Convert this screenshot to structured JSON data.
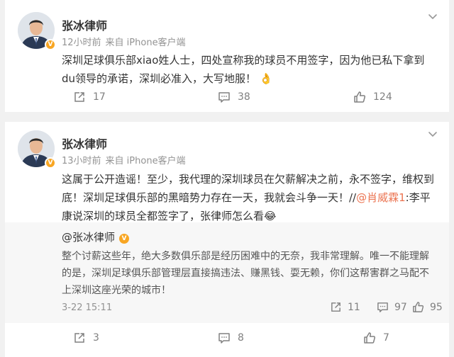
{
  "posts": [
    {
      "author": "张冰律师",
      "verified_badge": "V",
      "time": "12小时前",
      "source": "来自 iPhone客户端",
      "text": "深圳足球俱乐部xiao姓人士，四处宣称我的球员不用签字，因为他已私下拿到du领导的承诺，深圳必准入，大写地服！",
      "emoji": "👌",
      "actions": {
        "repost": "17",
        "comment": "38",
        "like": "124"
      }
    },
    {
      "author": "张冰律师",
      "verified_badge": "V",
      "time": "13小时前",
      "source": "来自 iPhone客户端",
      "text_before": "这属于公开造谣！至少，我代理的深圳球员在欠薪解决之前，永不签字，维权到底！深圳足球俱乐部的黑暗势力存在一天，我就会斗争一天！//",
      "mention": "@肖威霖1",
      "text_after": ":李平康说深圳的球员全都签字了，张律师怎么看",
      "emoji": "😂",
      "actions": {
        "repost": "3",
        "comment": "8",
        "like": "7"
      },
      "quoted": {
        "author": "@张冰律师",
        "verified_badge": "V",
        "text": "整个讨薪这些年，绝大多数俱乐部是经历困难中的无奈，我非常理解。唯一不能理解的是，深圳足球俱乐部管理层直接搞违法、赚黑钱、耍无赖，你们这帮害群之马配不上深圳这座光荣的城市！",
        "date": "3-22 15:11",
        "actions": {
          "repost": "11",
          "comment": "97",
          "like": "95"
        }
      }
    }
  ],
  "colors": {
    "mention": "#eb7350",
    "badge": "#f8a623",
    "meta": "#939393",
    "quote_bg": "#f7f7f7"
  }
}
